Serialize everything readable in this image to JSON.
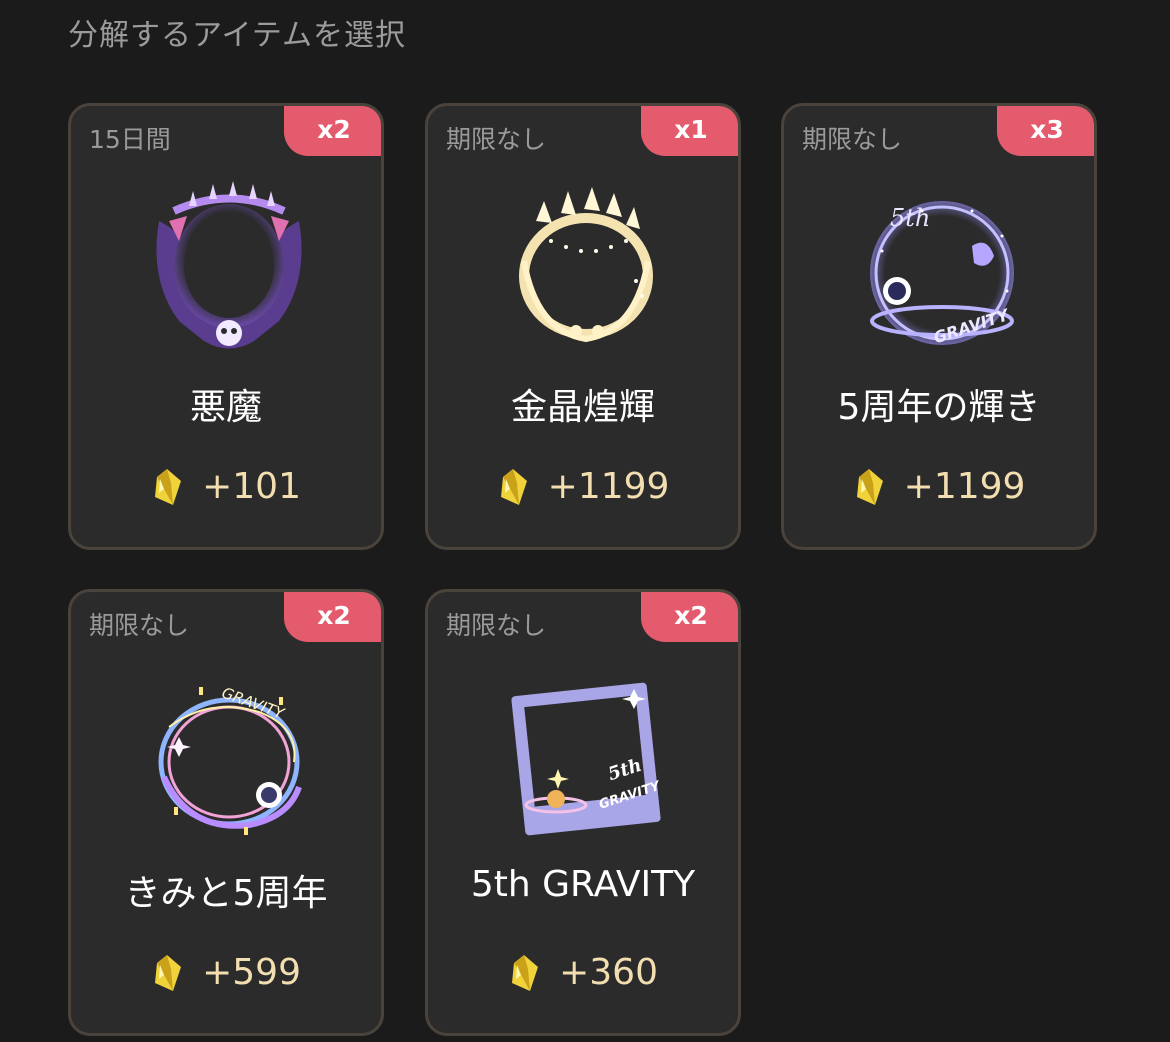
{
  "header": {
    "title": "分解するアイテムを選択"
  },
  "items": [
    {
      "period": "15日間",
      "count": "x2",
      "name": "悪魔",
      "reward": "+101",
      "icon": "demon-frame-icon"
    },
    {
      "period": "期限なし",
      "count": "x1",
      "name": "金晶煌輝",
      "reward": "+1199",
      "icon": "golden-crystal-frame-icon"
    },
    {
      "period": "期限なし",
      "count": "x3",
      "name": "5周年の輝き",
      "reward": "+1199",
      "icon": "anniversary-glow-frame-icon"
    },
    {
      "period": "期限なし",
      "count": "x2",
      "name": "きみと5周年",
      "reward": "+599",
      "icon": "anniversary-with-you-frame-icon"
    },
    {
      "period": "期限なし",
      "count": "x2",
      "name": "5th GRAVITY",
      "reward": "+360",
      "icon": "fifth-gravity-frame-icon"
    }
  ],
  "colors": {
    "background": "#1b1b1c",
    "card": "#2b2b2c",
    "card_border": "#4a433b",
    "badge": "#e35b6d",
    "reward_text": "#f3deb0",
    "crystal": "#f0d23a"
  },
  "decor": {
    "gravity_text": "GRAVITY",
    "fifth_text": "5th"
  }
}
